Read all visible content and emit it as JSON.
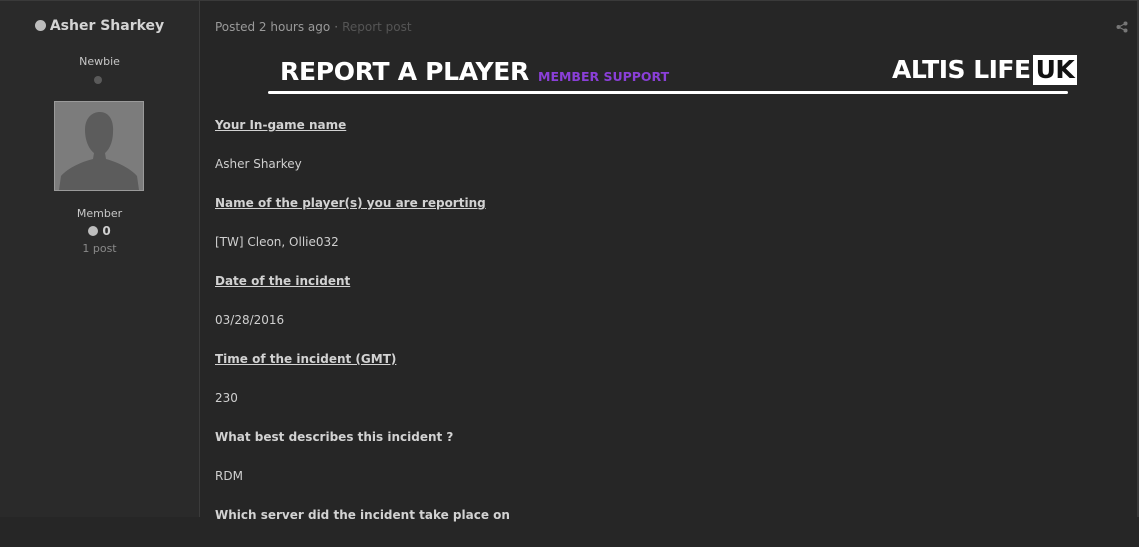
{
  "author": {
    "name": "Asher Sharkey",
    "rank": "Newbie",
    "group": "Member",
    "reputation": "0",
    "post_count": "1 post"
  },
  "post": {
    "posted": "Posted 2 hours ago",
    "report": "Report post"
  },
  "banner": {
    "title": "REPORT A PLAYER",
    "subtitle": "MEMBER SUPPORT",
    "logo_main": "ALTIS LIFE",
    "logo_box": "UK"
  },
  "fields": [
    {
      "q": "Your In-game name",
      "underlined": true
    },
    {
      "a": "Asher Sharkey"
    },
    {
      "q": "Name of the player(s) you are reporting",
      "underlined": true
    },
    {
      "a": "[TW] Cleon, Ollie032"
    },
    {
      "q": "Date of the incident",
      "underlined": true
    },
    {
      "a": "03/28/2016"
    },
    {
      "q": "Time of the incident (GMT)",
      "underlined": true
    },
    {
      "a": "230"
    },
    {
      "q": "What best describes this incident ?",
      "underlined": false
    },
    {
      "a": "RDM"
    },
    {
      "q": "Which server did the incident take place on",
      "underlined": false
    }
  ],
  "colors": {
    "accent_purple": "#8a3fd8",
    "background": "#262626",
    "sidebar": "#2a2a2a"
  },
  "icons": [
    "share-icon",
    "online-status-icon",
    "reputation-icon"
  ]
}
